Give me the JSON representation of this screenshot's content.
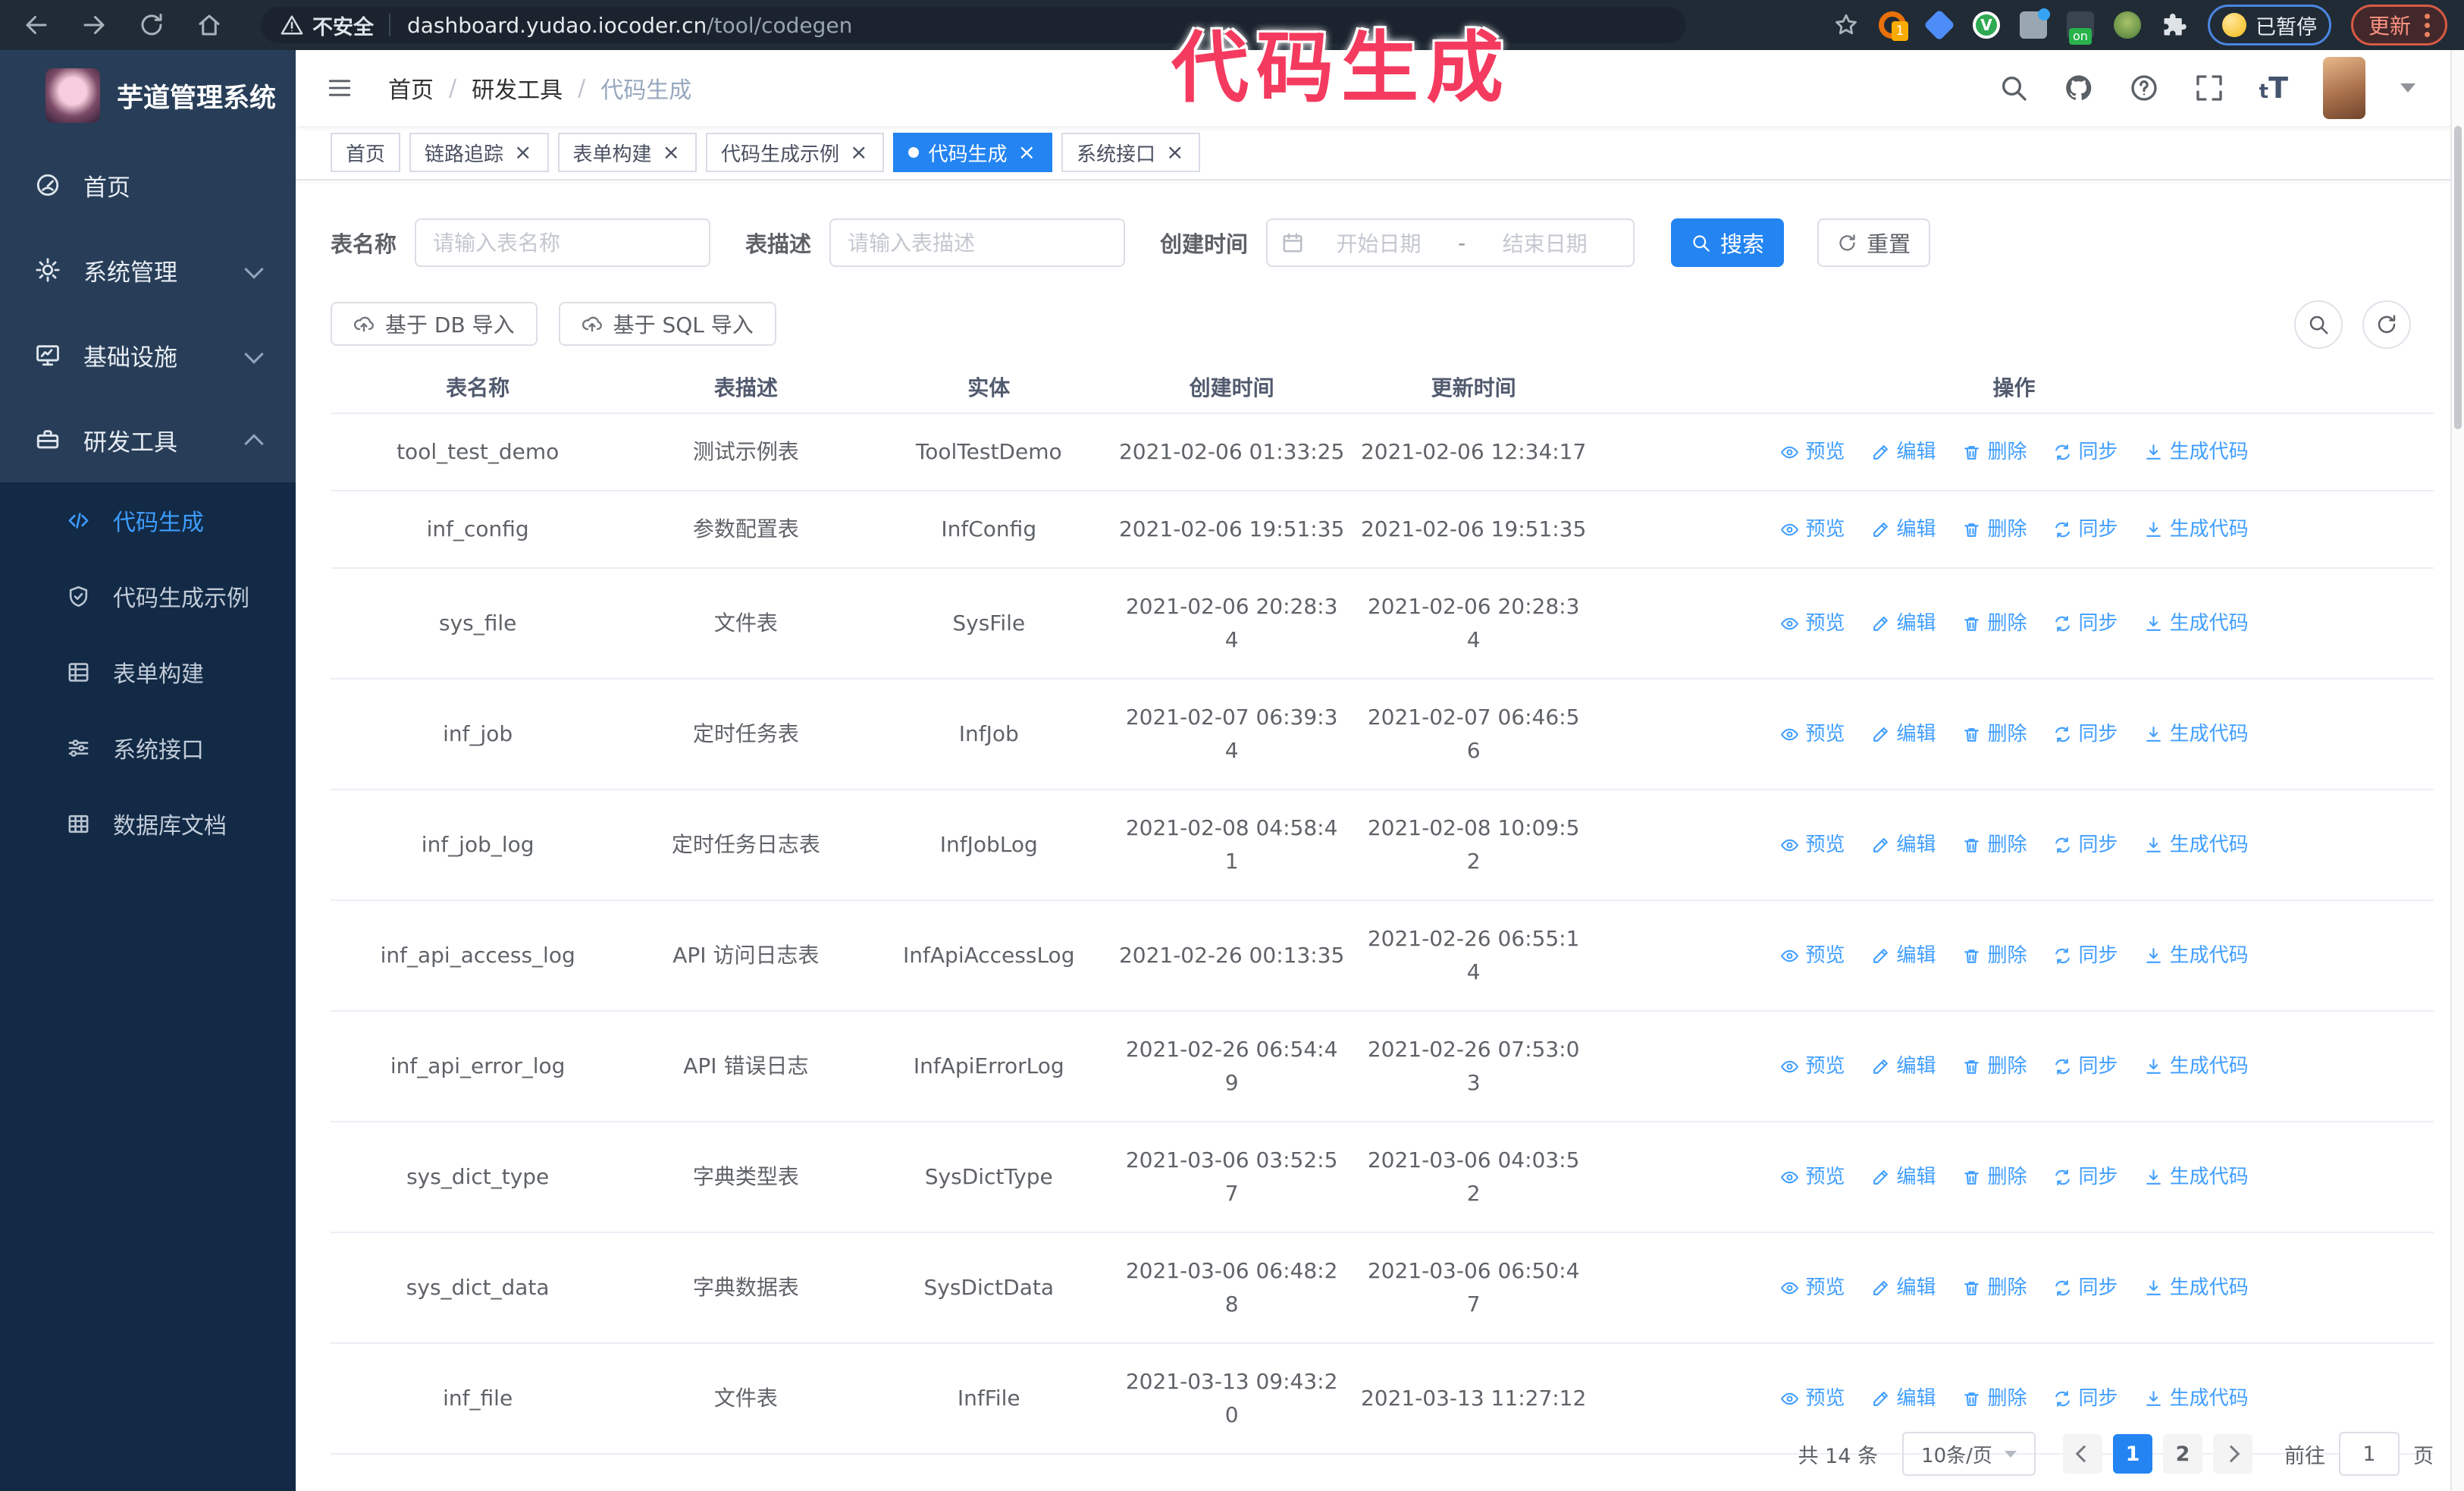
{
  "colors": {
    "primary": "#2384f2",
    "link": "#409eff",
    "annotation": "#f43b5f",
    "sidebar": "#283e58",
    "sidebar_dark": "#122a46",
    "browser_bar": "#212b36"
  },
  "browser": {
    "security_warning": "不安全",
    "url_host": "dashboard.yudao.iocoder.cn",
    "url_path": "/tool/codegen",
    "paused_badge": "已暂停",
    "update_button": "更新"
  },
  "annotation": {
    "text": "代码生成"
  },
  "sidebar": {
    "title": "芋道管理系统",
    "items": [
      {
        "label": "首页",
        "icon": "dashboard-icon",
        "type": "root"
      },
      {
        "label": "系统管理",
        "icon": "gear-icon",
        "type": "root",
        "chevron": "down"
      },
      {
        "label": "基础设施",
        "icon": "monitor-icon",
        "type": "root",
        "chevron": "down"
      },
      {
        "label": "研发工具",
        "icon": "toolbox-icon",
        "type": "root",
        "chevron": "up"
      },
      {
        "label": "代码生成",
        "icon": "code-icon",
        "type": "sub",
        "active": true
      },
      {
        "label": "代码生成示例",
        "icon": "shield-check-icon",
        "type": "sub"
      },
      {
        "label": "表单构建",
        "icon": "form-icon",
        "type": "sub"
      },
      {
        "label": "系统接口",
        "icon": "sliders-icon",
        "type": "sub"
      },
      {
        "label": "数据库文档",
        "icon": "table-grid-icon",
        "type": "sub"
      }
    ]
  },
  "header": {
    "breadcrumb": [
      "首页",
      "研发工具",
      "代码生成"
    ],
    "font_size_small": "t",
    "font_size_big": "T"
  },
  "tags_view": {
    "tabs": [
      {
        "label": "首页",
        "closable": false,
        "active": false
      },
      {
        "label": "链路追踪",
        "closable": true,
        "active": false
      },
      {
        "label": "表单构建",
        "closable": true,
        "active": false
      },
      {
        "label": "代码生成示例",
        "closable": true,
        "active": false
      },
      {
        "label": "代码生成",
        "closable": true,
        "active": true
      },
      {
        "label": "系统接口",
        "closable": true,
        "active": false
      }
    ]
  },
  "filters": {
    "table_name_label": "表名称",
    "table_name_placeholder": "请输入表名称",
    "table_desc_label": "表描述",
    "table_desc_placeholder": "请输入表描述",
    "create_time_label": "创建时间",
    "date_start_placeholder": "开始日期",
    "date_separator": "-",
    "date_end_placeholder": "结束日期",
    "search_button": "搜索",
    "reset_button": "重置"
  },
  "toolbar": {
    "import_db_button": "基于 DB 导入",
    "import_sql_button": "基于 SQL 导入"
  },
  "table": {
    "columns": [
      "表名称",
      "表描述",
      "实体",
      "创建时间",
      "更新时间",
      "操作"
    ],
    "row_actions": [
      {
        "label": "预览",
        "icon": "eye-icon"
      },
      {
        "label": "编辑",
        "icon": "edit-icon"
      },
      {
        "label": "删除",
        "icon": "delete-icon"
      },
      {
        "label": "同步",
        "icon": "sync-icon"
      },
      {
        "label": "生成代码",
        "icon": "download-icon"
      }
    ],
    "rows": [
      {
        "name": "tool_test_demo",
        "desc": "测试示例表",
        "entity": "ToolTestDemo",
        "created": "2021-02-06 01:33:25",
        "created_wrapped": false,
        "updated": "2021-02-06 12:34:17",
        "updated_wrapped": false
      },
      {
        "name": "inf_config",
        "desc": "参数配置表",
        "entity": "InfConfig",
        "created": "2021-02-06 19:51:35",
        "created_wrapped": false,
        "updated": "2021-02-06 19:51:35",
        "updated_wrapped": false
      },
      {
        "name": "sys_file",
        "desc": "文件表",
        "entity": "SysFile",
        "created": "2021-02-06 20:28:34",
        "created_wrapped": true,
        "updated": "2021-02-06 20:28:34",
        "updated_wrapped": true
      },
      {
        "name": "inf_job",
        "desc": "定时任务表",
        "entity": "InfJob",
        "created": "2021-02-07 06:39:34",
        "created_wrapped": true,
        "updated": "2021-02-07 06:46:56",
        "updated_wrapped": true
      },
      {
        "name": "inf_job_log",
        "desc": "定时任务日志表",
        "entity": "InfJobLog",
        "created": "2021-02-08 04:58:41",
        "created_wrapped": true,
        "updated": "2021-02-08 10:09:52",
        "updated_wrapped": true
      },
      {
        "name": "inf_api_access_log",
        "desc": "API 访问日志表",
        "entity": "InfApiAccessLog",
        "created": "2021-02-26 00:13:35",
        "created_wrapped": false,
        "updated": "2021-02-26 06:55:14",
        "updated_wrapped": true
      },
      {
        "name": "inf_api_error_log",
        "desc": "API 错误日志",
        "entity": "InfApiErrorLog",
        "created": "2021-02-26 06:54:49",
        "created_wrapped": true,
        "updated": "2021-02-26 07:53:03",
        "updated_wrapped": true
      },
      {
        "name": "sys_dict_type",
        "desc": "字典类型表",
        "entity": "SysDictType",
        "created": "2021-03-06 03:52:57",
        "created_wrapped": true,
        "updated": "2021-03-06 04:03:52",
        "updated_wrapped": true
      },
      {
        "name": "sys_dict_data",
        "desc": "字典数据表",
        "entity": "SysDictData",
        "created": "2021-03-06 06:48:28",
        "created_wrapped": true,
        "updated": "2021-03-06 06:50:47",
        "updated_wrapped": true
      },
      {
        "name": "inf_file",
        "desc": "文件表",
        "entity": "InfFile",
        "created": "2021-03-13 09:43:20",
        "created_wrapped": true,
        "updated": "2021-03-13 11:27:12",
        "updated_wrapped": false
      }
    ]
  },
  "pagination": {
    "total_text": "共 14 条",
    "page_size": "10条/页",
    "pages": [
      "1",
      "2"
    ],
    "active_page": "1",
    "goto_label": "前往",
    "goto_value": "1",
    "goto_suffix": "页"
  }
}
